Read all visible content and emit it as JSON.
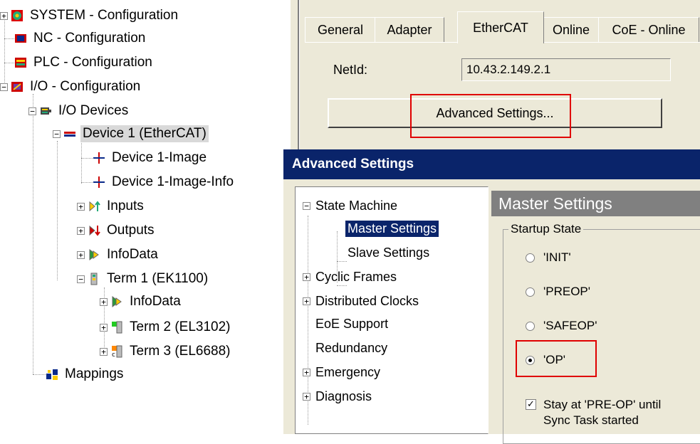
{
  "tree": {
    "system": "SYSTEM - Configuration",
    "nc": "NC - Configuration",
    "plc": "PLC - Configuration",
    "io": "I/O - Configuration",
    "io_devices": "I/O Devices",
    "device1": "Device 1 (EtherCAT)",
    "device1_image": "Device 1-Image",
    "device1_image_info": "Device 1-Image-Info",
    "inputs": "Inputs",
    "outputs": "Outputs",
    "infodata": "InfoData",
    "term1": "Term 1 (EK1100)",
    "term1_infodata": "InfoData",
    "term2": "Term 2 (EL3102)",
    "term3": "Term 3 (EL6688)",
    "mappings": "Mappings"
  },
  "tabs": [
    "General",
    "Adapter",
    "EtherCAT",
    "Online",
    "CoE - Online"
  ],
  "netid": {
    "label": "NetId:",
    "value": "10.43.2.149.2.1"
  },
  "advanced_button": "Advanced Settings...",
  "dialog": {
    "title": "Advanced Settings",
    "tree": {
      "state_machine": "State Machine",
      "master_settings": "Master Settings",
      "slave_settings": "Slave Settings",
      "cyclic_frames": "Cyclic Frames",
      "distributed_clocks": "Distributed Clocks",
      "eoe_support": "EoE Support",
      "redundancy": "Redundancy",
      "emergency": "Emergency",
      "diagnosis": "Diagnosis"
    },
    "section_title": "Master Settings",
    "startup_state_label": "Startup State",
    "states": [
      "'INIT'",
      "'PREOP'",
      "'SAFEOP'",
      "'OP'"
    ],
    "selected_state": "'OP'",
    "stay_preop_line1": "Stay at 'PRE-OP' until",
    "stay_preop_line2": "Sync Task started",
    "stay_preop_checked": true
  },
  "colors": {
    "title_bar": "#0a246a",
    "highlight_box": "#e00000",
    "panel": "#ece9d8"
  }
}
